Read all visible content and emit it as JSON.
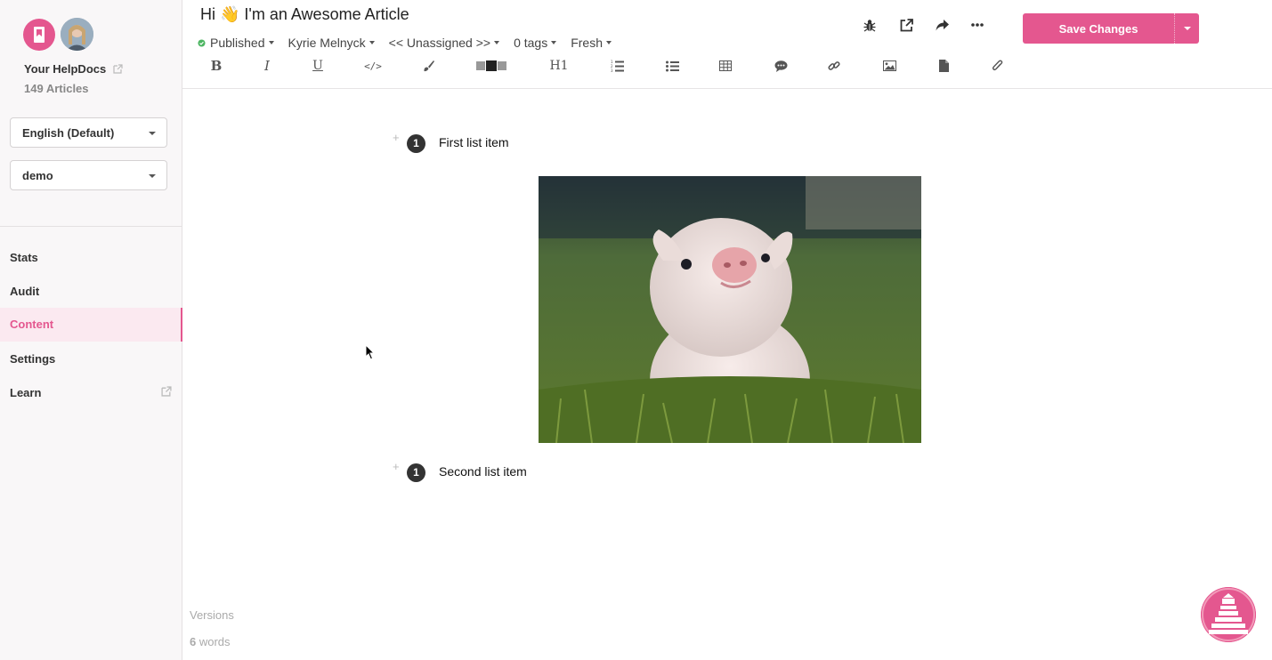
{
  "sidebar": {
    "site_name": "Your HelpDocs",
    "article_count": "149 Articles",
    "language_select": "English (Default)",
    "category_select": "demo",
    "nav": [
      {
        "label": "Stats"
      },
      {
        "label": "Audit"
      },
      {
        "label": "Content"
      },
      {
        "label": "Settings"
      },
      {
        "label": "Learn"
      }
    ],
    "versions_label": "Versions",
    "word_count": "6",
    "word_label": "words"
  },
  "header": {
    "title": "Hi 👋 I'm an Awesome Article",
    "status": "Published",
    "author": "Kyrie Melnyck",
    "category": "<< Unassigned >>",
    "tags": "0 tags",
    "freshness": "Fresh",
    "save_label": "Save Changes",
    "toolbar_glyphs": {
      "bold": "B",
      "italic": "I",
      "underline": "U",
      "code": "</>",
      "heading": "H1"
    }
  },
  "content": {
    "items": [
      {
        "number": "1",
        "text": "First list item"
      },
      {
        "number": "1",
        "text": "Second list item"
      }
    ]
  },
  "colors": {
    "accent": "#e4578f",
    "published_status": "#4cb561"
  }
}
